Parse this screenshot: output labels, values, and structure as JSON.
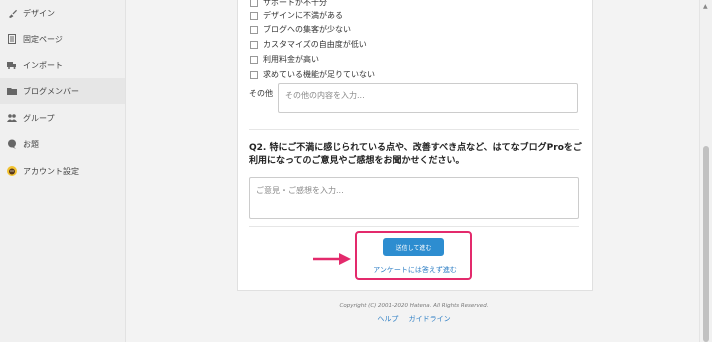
{
  "sidebar": {
    "items": [
      {
        "label": "デザイン",
        "icon": "brush-icon"
      },
      {
        "label": "固定ページ",
        "icon": "page-icon"
      },
      {
        "label": "インポート",
        "icon": "truck-icon"
      },
      {
        "label": "ブログメンバー",
        "icon": "folder-icon"
      },
      {
        "label": "グループ",
        "icon": "group-icon"
      },
      {
        "label": "お題",
        "icon": "speech-bubble-icon"
      },
      {
        "label": "アカウント設定",
        "icon": "avatar-icon"
      }
    ]
  },
  "survey": {
    "options": [
      "サポートが不十分",
      "デザインに不満がある",
      "ブログへの集客が少ない",
      "カスタマイズの自由度が低い",
      "利用料金が高い",
      "求めている機能が足りていない"
    ],
    "other_label": "その他",
    "other_placeholder": "その他の内容を入力...",
    "q2_text": "Q2. 特にご不満に感じられている点や、改善すべき点など、はてなブログProをご利用になってのご意見やご感想をお聞かせください。",
    "q2_placeholder": "ご意見・ご感想を入力...",
    "submit_label": "送信して進む",
    "skip_label": "アンケートには答えず進む"
  },
  "footer": {
    "copyright": "Copyright (C) 2001-2020 Hatena. All Rights Reserved.",
    "help": "ヘルプ",
    "guideline": "ガイドライン"
  },
  "colors": {
    "accent": "#2d8dd0",
    "highlight": "#e32a6c",
    "link": "#2d7ec4"
  }
}
